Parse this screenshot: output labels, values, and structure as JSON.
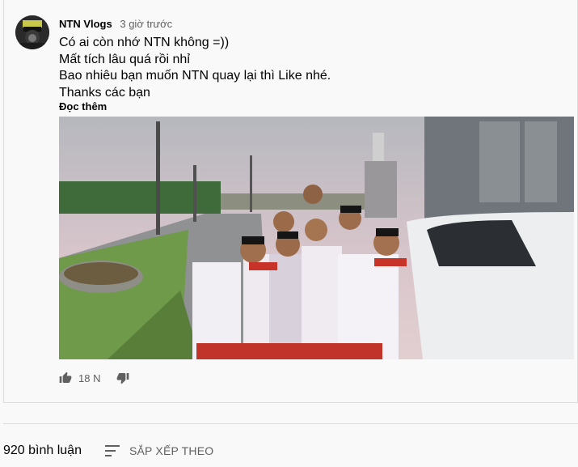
{
  "post": {
    "author": "NTN Vlogs",
    "time": "3 giờ trước",
    "lines": [
      "Có ai còn nhớ NTN không =))",
      "Mất tích lâu quá rồi nhỉ",
      "Bao nhiêu bạn muốn NTN quay lại thì Like nhé.",
      "Thanks các bạn"
    ],
    "read_more": "Đọc thêm",
    "like_count": "18 N"
  },
  "comments": {
    "count_label": "920 bình luận",
    "sort_label": "SẮP XẾP THEO"
  },
  "icons": {
    "like": "thumb-up-icon",
    "dislike": "thumb-down-icon",
    "sort": "sort-lines-icon"
  },
  "colors": {
    "secondary_text": "#606060",
    "divider": "#dcdcdc"
  }
}
